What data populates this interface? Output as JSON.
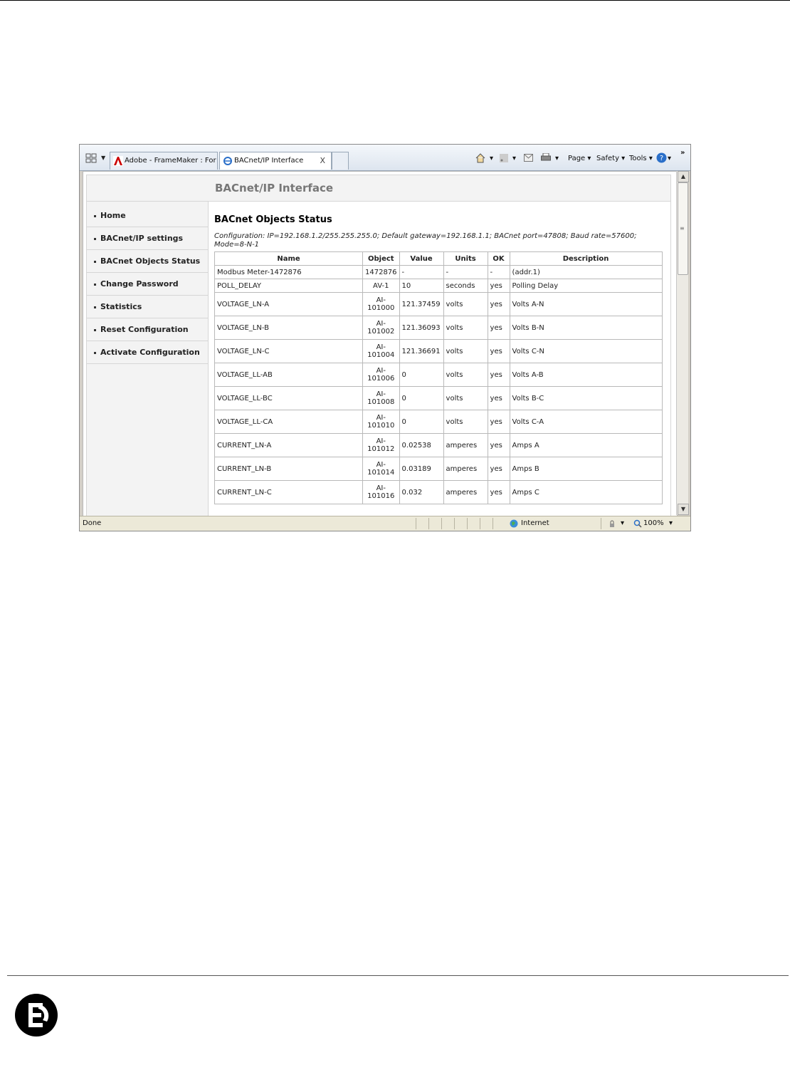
{
  "browser": {
    "tabs": [
      {
        "label": "Adobe - FrameMaker : For W...",
        "active": false
      },
      {
        "label": "BACnet/IP Interface",
        "active": true,
        "close": "X"
      },
      {
        "label": "",
        "active": false
      }
    ],
    "toolbar": {
      "page_label": "Page",
      "safety_label": "Safety",
      "tools_label": "Tools",
      "more_label": "»"
    },
    "status": {
      "text": "Done",
      "zone": "Internet",
      "zoom": "100%"
    }
  },
  "page": {
    "banner_title": "BACnet/IP Interface",
    "menu": [
      "Home",
      "BACnet/IP settings",
      "BACnet Objects Status",
      "Change Password",
      "Statistics",
      "Reset Configuration",
      "Activate Configuration"
    ],
    "heading": "BACnet Objects Status",
    "configuration": "Configuration: IP=192.168.1.2/255.255.255.0; Default gateway=192.168.1.1; BACnet port=47808; Baud rate=57600; Mode=8-N-1",
    "table": {
      "headers": [
        "Name",
        "Object",
        "Value",
        "Units",
        "OK",
        "Description"
      ],
      "rows": [
        {
          "name": "Modbus Meter-1472876",
          "object": "1472876",
          "value": "-",
          "units": "-",
          "ok": "-",
          "description": "(addr.1)"
        },
        {
          "name": "POLL_DELAY",
          "object": "AV-1",
          "value": "10",
          "units": "seconds",
          "ok": "yes",
          "description": "Polling Delay"
        },
        {
          "name": "VOLTAGE_LN-A",
          "object": "AI-101000",
          "value": "121.37459",
          "units": "volts",
          "ok": "yes",
          "description": "Volts A-N"
        },
        {
          "name": "VOLTAGE_LN-B",
          "object": "AI-101002",
          "value": "121.36093",
          "units": "volts",
          "ok": "yes",
          "description": "Volts B-N"
        },
        {
          "name": "VOLTAGE_LN-C",
          "object": "AI-101004",
          "value": "121.36691",
          "units": "volts",
          "ok": "yes",
          "description": "Volts C-N"
        },
        {
          "name": "VOLTAGE_LL-AB",
          "object": "AI-101006",
          "value": "0",
          "units": "volts",
          "ok": "yes",
          "description": "Volts A-B"
        },
        {
          "name": "VOLTAGE_LL-BC",
          "object": "AI-101008",
          "value": "0",
          "units": "volts",
          "ok": "yes",
          "description": "Volts B-C"
        },
        {
          "name": "VOLTAGE_LL-CA",
          "object": "AI-101010",
          "value": "0",
          "units": "volts",
          "ok": "yes",
          "description": "Volts C-A"
        },
        {
          "name": "CURRENT_LN-A",
          "object": "AI-101012",
          "value": "0.02538",
          "units": "amperes",
          "ok": "yes",
          "description": "Amps A"
        },
        {
          "name": "CURRENT_LN-B",
          "object": "AI-101014",
          "value": "0.03189",
          "units": "amperes",
          "ok": "yes",
          "description": "Amps B"
        },
        {
          "name": "CURRENT_LN-C",
          "object": "AI-101016",
          "value": "0.032",
          "units": "amperes",
          "ok": "yes",
          "description": "Amps C"
        }
      ]
    }
  },
  "colors": {
    "logo": "#000000",
    "accent_red": "#cc0000",
    "ie_blue": "#2a6fc9"
  }
}
